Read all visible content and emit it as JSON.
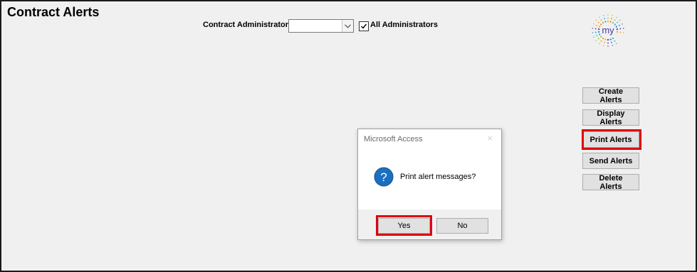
{
  "form": {
    "title": "Contract Alerts",
    "admin_label": "Contract Administrator:",
    "admin_value": "",
    "all_admins_label": "All Administrators",
    "all_admins_checked": true,
    "logo_text": "my"
  },
  "buttons": {
    "create": "Create Alerts",
    "display": "Display Alerts",
    "print": "Print Alerts",
    "send": "Send Alerts",
    "delete": "Delete Alerts"
  },
  "dialog": {
    "title": "Microsoft Access",
    "close_icon": "×",
    "icon": "question-icon",
    "message": "Print alert messages?",
    "yes": "Yes",
    "no": "No"
  },
  "colors": {
    "highlight": "#e0000f",
    "icon_blue": "#1c6fbf"
  }
}
